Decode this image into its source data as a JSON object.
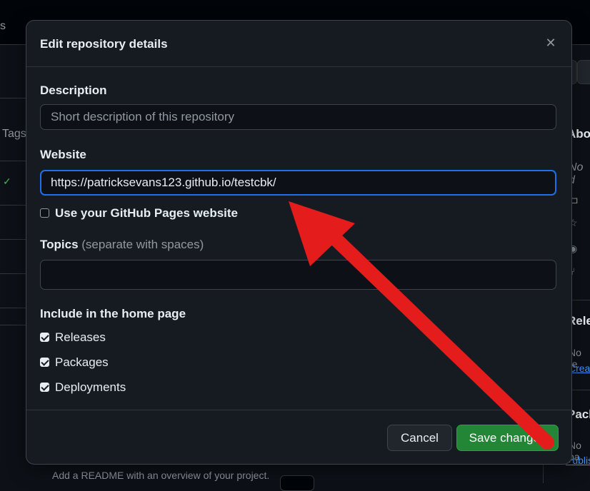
{
  "background": {
    "frag_left": "s",
    "tags_label": "Tags",
    "right_about": "Abo",
    "right_desc": "No d",
    "right_releases": "Rele",
    "right_no_releases": "No re",
    "right_create_link": "Create",
    "right_packages": "Pack",
    "right_no_packages": "No pa",
    "right_publish_link": "Publis",
    "readme_text": "Add a README with an overview of your project."
  },
  "dialog": {
    "title": "Edit repository details",
    "close_icon": "close-icon",
    "description": {
      "label": "Description",
      "value": "",
      "placeholder": "Short description of this repository"
    },
    "website": {
      "label": "Website",
      "value": "https://patricksevans123.github.io/testcbk/"
    },
    "use_pages": {
      "label": "Use your GitHub Pages website",
      "checked": false
    },
    "topics": {
      "label": "Topics",
      "hint": "(separate with spaces)",
      "value": ""
    },
    "home_page": {
      "label": "Include in the home page",
      "options": [
        {
          "label": "Releases",
          "checked": true
        },
        {
          "label": "Packages",
          "checked": true
        },
        {
          "label": "Deployments",
          "checked": true
        }
      ]
    },
    "buttons": {
      "cancel": "Cancel",
      "save": "Save changes"
    }
  },
  "annotation": {
    "arrow_color": "#e51c1c"
  },
  "colors": {
    "accent_blue": "#1f6feb",
    "save_green": "#238636"
  }
}
